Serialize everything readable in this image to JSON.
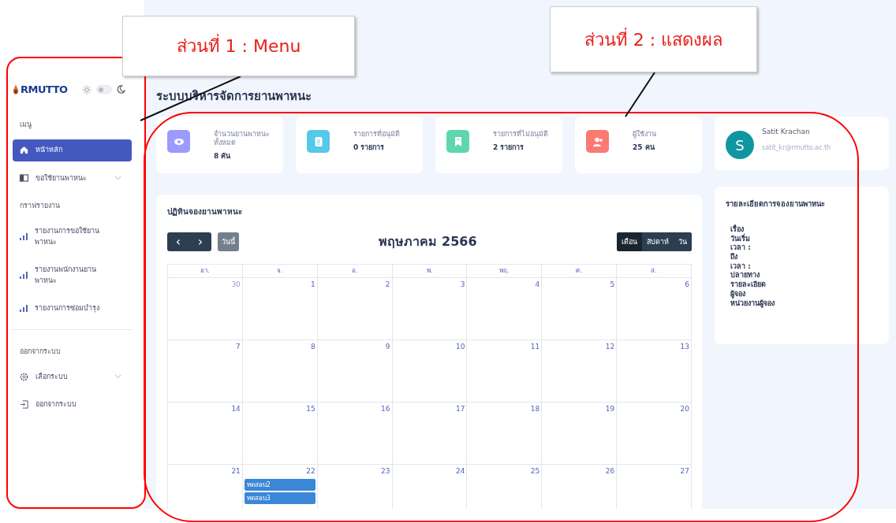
{
  "sidebar": {
    "logo": "RMUTTO",
    "dark_mode": false,
    "sections": [
      {
        "heading": "เมนู",
        "items": [
          {
            "label": "หน้าหลัก",
            "selected": true,
            "expandable": false
          },
          {
            "label": "ขอใช้ยานพาหนะ",
            "selected": false,
            "expandable": true
          }
        ]
      },
      {
        "heading": "กราฟรายงาน",
        "items": [
          {
            "label": "รายงานการขอใช้ยานพาหนะ",
            "selected": false,
            "expandable": false
          },
          {
            "label": "รายงานพนักงานยานพาหนะ",
            "selected": false,
            "expandable": false
          },
          {
            "label": "รายงานการซ่อมบำรุง",
            "selected": false,
            "expandable": false
          }
        ]
      },
      {
        "heading": "ออกจากระบบ",
        "items": [
          {
            "label": "เลือกระบบ",
            "selected": false,
            "expandable": true
          },
          {
            "label": "ออกจากระบบ",
            "selected": false,
            "expandable": false
          }
        ]
      }
    ]
  },
  "page_title": "ระบบบริหารจัดการยานพาหนะ",
  "stats": [
    {
      "label": "จำนวนยานพาหนะทั้งหมด",
      "value": "8 คัน",
      "color": "#9b9bff"
    },
    {
      "label": "รายการที่อนุมัติ",
      "value": "0 รายการ",
      "color": "#56c8ea"
    },
    {
      "label": "รายการที่ไม่อนุมัติ",
      "value": "2 รายการ",
      "color": "#5fd6ad"
    },
    {
      "label": "ผู้ใช้งาน",
      "value": "25 คน",
      "color": "#fb7a72"
    }
  ],
  "user": {
    "initial": "S",
    "name": "Satit Krachan",
    "email": "satit_kr@rmutto.ac.th"
  },
  "calendar": {
    "title": "ปฏิทินจองยานพาหนะ",
    "prev": "‹",
    "next": "›",
    "today": "วันนี้",
    "month": "พฤษภาคม 2566",
    "views": [
      {
        "label": "เดือน",
        "selected": true
      },
      {
        "label": "สัปดาห์",
        "selected": false
      },
      {
        "label": "วัน",
        "selected": false
      }
    ],
    "weekdays": [
      "อา.",
      "จ.",
      "อ.",
      "พ.",
      "พฤ.",
      "ศ.",
      "ส."
    ],
    "weeks": [
      [
        {
          "day": "30",
          "other_month": true
        },
        {
          "day": "1",
          "other_month": false
        },
        {
          "day": "2",
          "other_month": false
        },
        {
          "day": "3",
          "other_month": false
        },
        {
          "day": "4",
          "other_month": false
        },
        {
          "day": "5",
          "other_month": false
        },
        {
          "day": "6",
          "other_month": false
        }
      ],
      [
        {
          "day": "7",
          "other_month": false
        },
        {
          "day": "8",
          "other_month": false
        },
        {
          "day": "9",
          "other_month": false
        },
        {
          "day": "10",
          "other_month": false
        },
        {
          "day": "11",
          "other_month": false
        },
        {
          "day": "12",
          "other_month": false
        },
        {
          "day": "13",
          "other_month": false
        }
      ],
      [
        {
          "day": "14",
          "other_month": false
        },
        {
          "day": "15",
          "other_month": false
        },
        {
          "day": "16",
          "other_month": false
        },
        {
          "day": "17",
          "other_month": false
        },
        {
          "day": "18",
          "other_month": false
        },
        {
          "day": "19",
          "other_month": false
        },
        {
          "day": "20",
          "other_month": false
        }
      ],
      [
        {
          "day": "21",
          "other_month": false
        },
        {
          "day": "22",
          "other_month": false,
          "events": [
            "ทดสอบ2",
            "ทดสอบ3"
          ]
        },
        {
          "day": "23",
          "other_month": false
        },
        {
          "day": "24",
          "other_month": false
        },
        {
          "day": "25",
          "other_month": false
        },
        {
          "day": "26",
          "other_month": false
        },
        {
          "day": "27",
          "other_month": false
        }
      ]
    ]
  },
  "details": {
    "title": "รายละเอียดการจองยานพาหนะ",
    "fields": [
      "เรื่อง",
      "วันเริ่ม",
      "เวลา :",
      "ถึง",
      "เวลา :",
      "ปลายทาง",
      "รายละเอียด",
      "ผู้จอง",
      "หน่วยงานผู้จอง"
    ]
  },
  "annotations": [
    {
      "text": "ส่วนที่ 1 : Menu"
    },
    {
      "text": "ส่วนที่ 2 : แสดงผล"
    }
  ]
}
